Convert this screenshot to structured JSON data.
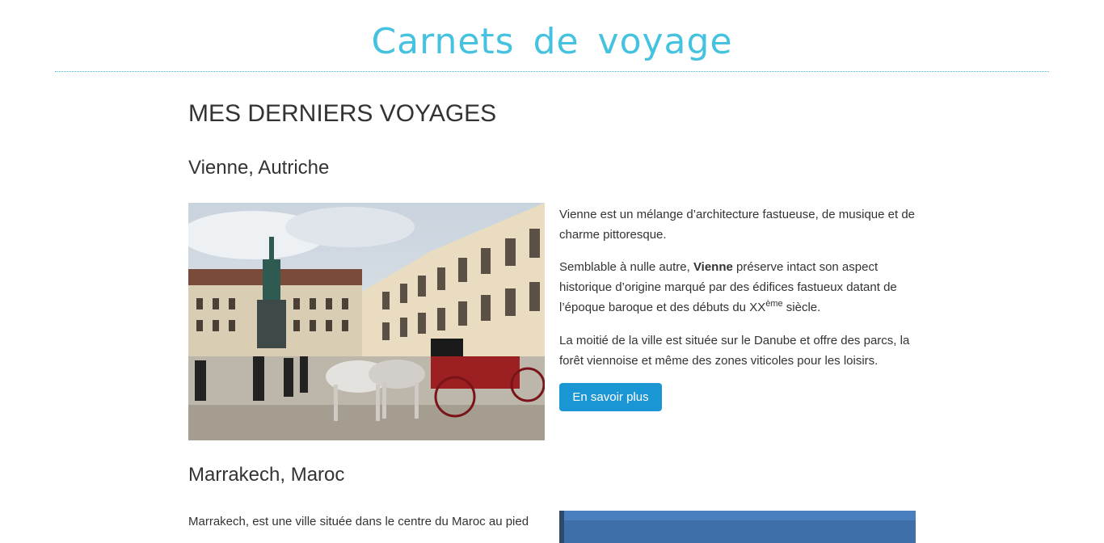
{
  "site": {
    "title": "Carnets de voyage"
  },
  "main": {
    "section_title": "MES DERNIERS VOYAGES",
    "trips": [
      {
        "title": "Vienne, Autriche",
        "paragraph1": "Vienne est un mélange d’architecture fastueuse, de musique et de charme pittoresque.",
        "paragraph2_before": "Semblable à nulle autre, ",
        "paragraph2_bold": "Vienne",
        "paragraph2_after": " préserve intact son aspect historique d’origine marqué par des édifices fastueux datant de l’époque baroque et des débuts du XX",
        "paragraph2_sup": "ème",
        "paragraph2_end": " siècle.",
        "paragraph3": "La moitié de la ville est située sur le Danube et offre des parcs, la forêt viennoise et même des zones viticoles pour les loisirs.",
        "button_label": "En savoir plus"
      },
      {
        "title": "Marrakech, Maroc",
        "paragraph1": "Marrakech, est une ville située dans le centre du Maroc au pied"
      }
    ]
  },
  "colors": {
    "accent": "#45c2e0",
    "button": "#1a96d4",
    "text": "#333333"
  }
}
